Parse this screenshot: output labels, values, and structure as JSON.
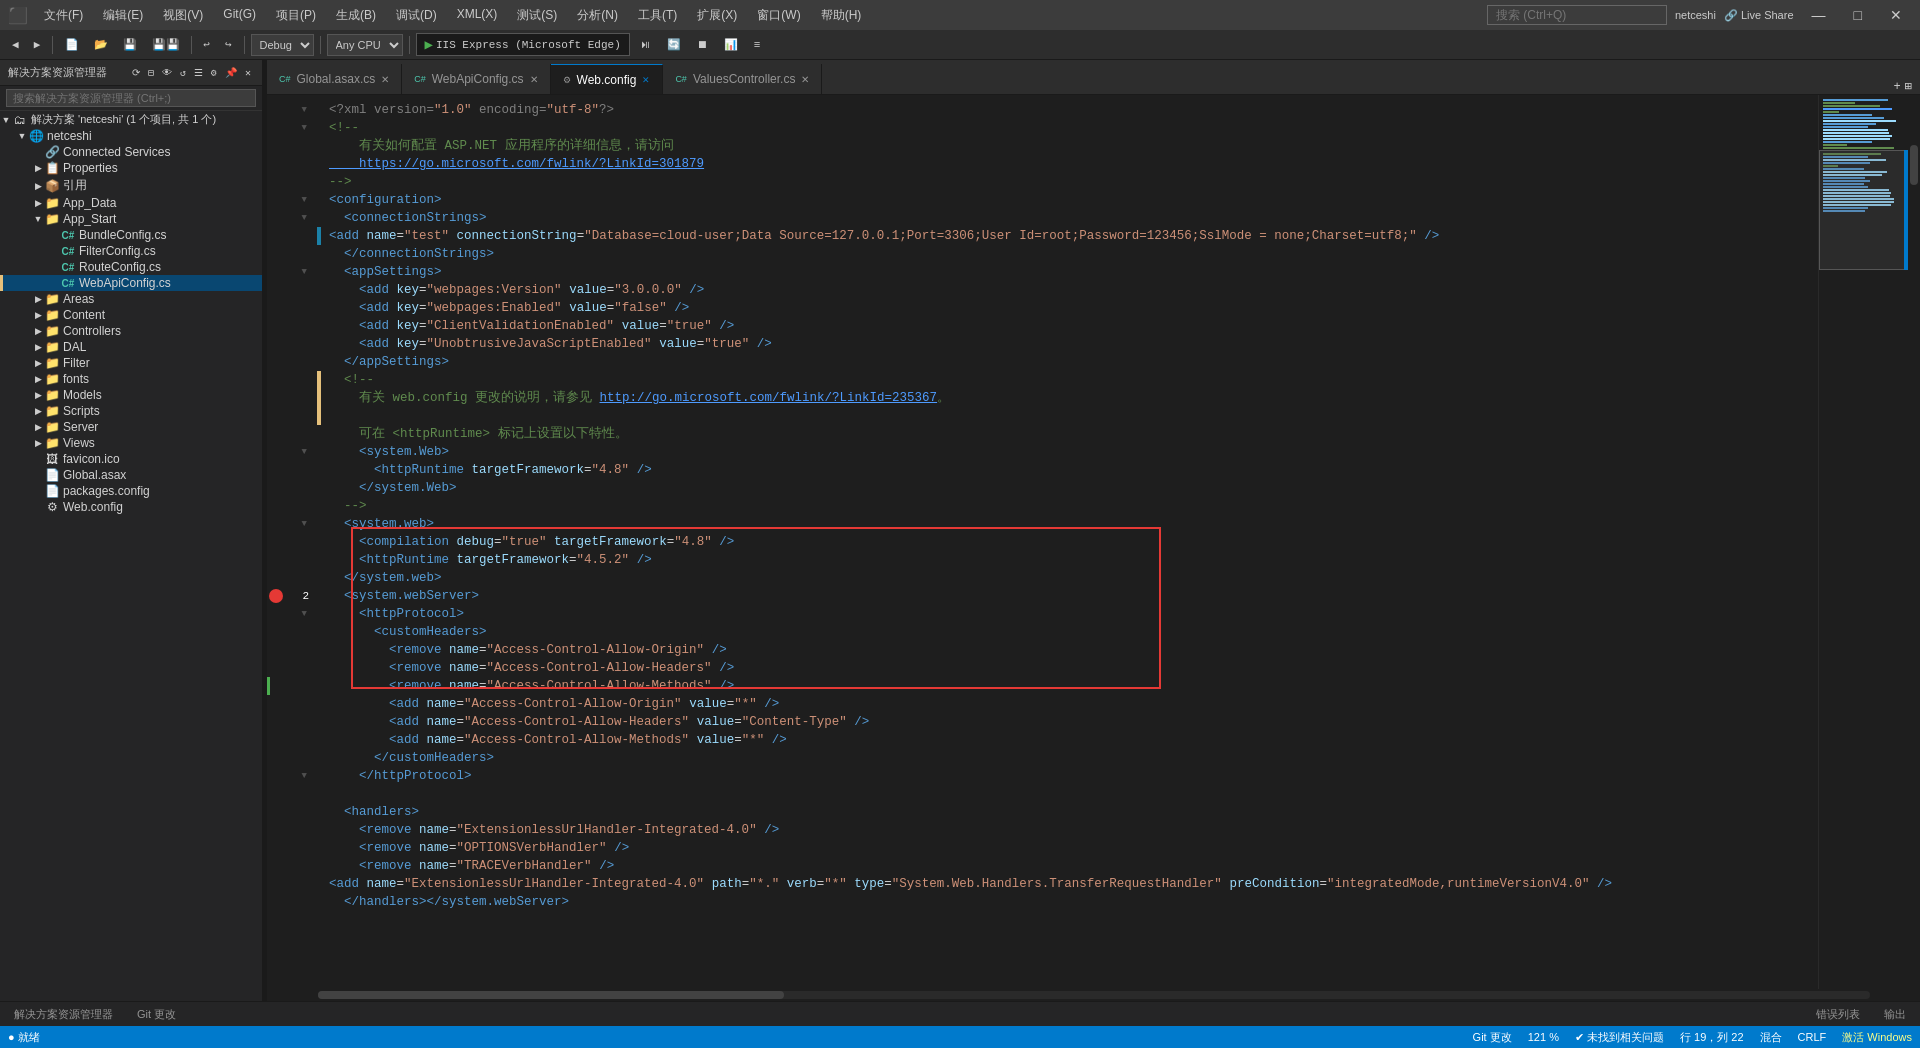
{
  "titleBar": {
    "menuItems": [
      "文件(F)",
      "编辑(E)",
      "视图(V)",
      "Git(G)",
      "项目(P)",
      "生成(B)",
      "调试(D)",
      "XML(X)",
      "测试(S)",
      "分析(N)",
      "工具(T)",
      "扩展(X)",
      "窗口(W)",
      "帮助(H)"
    ],
    "searchPlaceholder": "搜索 (Ctrl+Q)",
    "userName": "netceshi",
    "liveShare": "Live Share",
    "windowControls": [
      "—",
      "□",
      "✕"
    ]
  },
  "toolbar": {
    "config": "Debug",
    "platform": "Any CPU",
    "runTarget": "IIS Express (Microsoft Edge)"
  },
  "solutionExplorer": {
    "title": "解决方案资源管理器",
    "searchPlaceholder": "搜索解决方案资源管理器 (Ctrl+;)",
    "solutionName": "解决方案 'netceshi' (1 个项目, 共 1 个)",
    "projectName": "netceshi",
    "items": [
      {
        "label": "Connected Services",
        "indent": 2,
        "icon": "🔗",
        "type": "item"
      },
      {
        "label": "Properties",
        "indent": 2,
        "icon": "📋",
        "type": "folder"
      },
      {
        "label": "引用",
        "indent": 2,
        "icon": "📦",
        "type": "folder"
      },
      {
        "label": "App_Data",
        "indent": 2,
        "icon": "📁",
        "type": "folder"
      },
      {
        "label": "App_Start",
        "indent": 2,
        "icon": "📁",
        "type": "folder",
        "expanded": true
      },
      {
        "label": "BundleConfig.cs",
        "indent": 3,
        "icon": "C#",
        "type": "file"
      },
      {
        "label": "FilterConfig.cs",
        "indent": 3,
        "icon": "C#",
        "type": "file"
      },
      {
        "label": "RouteConfig.cs",
        "indent": 3,
        "icon": "C#",
        "type": "file"
      },
      {
        "label": "WebApiConfig.cs",
        "indent": 3,
        "icon": "C#",
        "type": "file",
        "selected": true
      },
      {
        "label": "Areas",
        "indent": 2,
        "icon": "📁",
        "type": "folder"
      },
      {
        "label": "Content",
        "indent": 2,
        "icon": "📁",
        "type": "folder"
      },
      {
        "label": "Controllers",
        "indent": 2,
        "icon": "📁",
        "type": "folder"
      },
      {
        "label": "DAL",
        "indent": 2,
        "icon": "📁",
        "type": "folder"
      },
      {
        "label": "Filter",
        "indent": 2,
        "icon": "📁",
        "type": "folder"
      },
      {
        "label": "fonts",
        "indent": 2,
        "icon": "📁",
        "type": "folder"
      },
      {
        "label": "Models",
        "indent": 2,
        "icon": "📁",
        "type": "folder"
      },
      {
        "label": "Scripts",
        "indent": 2,
        "icon": "📁",
        "type": "folder"
      },
      {
        "label": "Server",
        "indent": 2,
        "icon": "📁",
        "type": "folder"
      },
      {
        "label": "Views",
        "indent": 2,
        "icon": "📁",
        "type": "folder"
      },
      {
        "label": "favicon.ico",
        "indent": 2,
        "icon": "🖼",
        "type": "file"
      },
      {
        "label": "Global.asax",
        "indent": 2,
        "icon": "📄",
        "type": "file"
      },
      {
        "label": "packages.config",
        "indent": 2,
        "icon": "📄",
        "type": "file"
      },
      {
        "label": "Web.config",
        "indent": 2,
        "icon": "⚙",
        "type": "file"
      }
    ]
  },
  "tabs": [
    {
      "label": "Global.asax.cs",
      "active": false,
      "modified": false
    },
    {
      "label": "WebApiConfig.cs",
      "active": false,
      "modified": false
    },
    {
      "label": "Web.config",
      "active": true,
      "modified": false,
      "pinned": false
    },
    {
      "label": "ValuesController.cs",
      "active": false,
      "modified": false
    }
  ],
  "codeLines": [
    {
      "num": "",
      "fold": "▼",
      "code": "<?xml version=\"1.0\" encoding=\"utf-8\"?>",
      "class": "xml-pi"
    },
    {
      "num": "",
      "fold": "▼",
      "code": "<!--",
      "class": "xml-comment"
    },
    {
      "num": "",
      "fold": "",
      "code": "    有关如何配置 ASP.NET 应用程序的详细信息，请访问",
      "class": "xml-comment"
    },
    {
      "num": "",
      "fold": "",
      "code": "    https://go.microsoft.com/fwlink/?LinkId=301879",
      "class": "link-color"
    },
    {
      "num": "",
      "fold": "",
      "code": "-->",
      "class": "xml-comment"
    },
    {
      "num": "",
      "fold": "▼",
      "code": "<configuration>",
      "class": "xml-tag"
    },
    {
      "num": "",
      "fold": "▼",
      "code": "  <connectionStrings>",
      "class": "xml-tag"
    },
    {
      "num": "",
      "fold": "",
      "code": "    <add name=\"test\" connectionString=\"Database=cloud-user;Data Source=127.0.0.1;Port=3306;User Id=root;Password=123456;SslMode = none;Charset=utf8;\" />",
      "class": "xml-attr"
    },
    {
      "num": "",
      "fold": "",
      "code": "  </connectionStrings>",
      "class": "xml-tag"
    },
    {
      "num": "",
      "fold": "▼",
      "code": "  <appSettings>",
      "class": "xml-tag"
    },
    {
      "num": "",
      "fold": "",
      "code": "    <add key=\"webpages:Version\" value=\"3.0.0.0\" />",
      "class": "xml-attr"
    },
    {
      "num": "",
      "fold": "",
      "code": "    <add key=\"webpages:Enabled\" value=\"false\" />",
      "class": "xml-attr"
    },
    {
      "num": "",
      "fold": "",
      "code": "    <add key=\"ClientValidationEnabled\" value=\"true\" />",
      "class": "xml-attr"
    },
    {
      "num": "",
      "fold": "",
      "code": "    <add key=\"UnobtrusiveJavaScriptEnabled\" value=\"true\" />",
      "class": "xml-attr"
    },
    {
      "num": "",
      "fold": "",
      "code": "  </appSettings>",
      "class": "xml-tag"
    },
    {
      "num": "",
      "fold": "",
      "code": "  <!--",
      "class": "xml-comment"
    },
    {
      "num": "",
      "fold": "",
      "code": "    有关 web.config 更改的说明，请参见 http://go.microsoft.com/fwlink/?LinkId=235367。",
      "class": "xml-comment"
    },
    {
      "num": "",
      "fold": "",
      "code": "",
      "class": ""
    },
    {
      "num": "",
      "fold": "",
      "code": "    可在 <httpRuntime> 标记上设置以下特性。",
      "class": "xml-comment"
    },
    {
      "num": "",
      "fold": "▼",
      "code": "    <system.Web>",
      "class": "xml-tag"
    },
    {
      "num": "",
      "fold": "",
      "code": "      <httpRuntime targetFramework=\"4.8\" />",
      "class": "xml-attr"
    },
    {
      "num": "",
      "fold": "",
      "code": "    </system.Web>",
      "class": "xml-tag"
    },
    {
      "num": "",
      "fold": "",
      "code": "  -->",
      "class": "xml-comment"
    },
    {
      "num": "",
      "fold": "▼",
      "code": "  <system.web>",
      "class": "xml-tag"
    },
    {
      "num": "",
      "fold": "",
      "code": "    <compilation debug=\"true\" targetFramework=\"4.8\" />",
      "class": "xml-attr"
    },
    {
      "num": "",
      "fold": "",
      "code": "    <httpRuntime targetFramework=\"4.5.2\" />",
      "class": "xml-attr"
    },
    {
      "num": "",
      "fold": "",
      "code": "  </system.web>",
      "class": "xml-tag"
    },
    {
      "num": "",
      "fold": "▼",
      "code": "  <system.webServer>",
      "class": "xml-tag"
    },
    {
      "num": "2",
      "fold": "▼",
      "code": "    <httpProtocol>",
      "class": "xml-tag",
      "bp": true
    },
    {
      "num": "",
      "fold": "▼",
      "code": "      <customHeaders>",
      "class": "xml-tag",
      "highlight": true
    },
    {
      "num": "",
      "fold": "",
      "code": "        <remove name=\"Access-Control-Allow-Origin\" />",
      "class": "xml-attr",
      "highlight": true
    },
    {
      "num": "",
      "fold": "",
      "code": "        <remove name=\"Access-Control-Allow-Headers\" />",
      "class": "xml-attr",
      "highlight": true
    },
    {
      "num": "",
      "fold": "",
      "code": "        <remove name=\"Access-Control-Allow-Methods\" />",
      "class": "xml-attr",
      "highlight": true
    },
    {
      "num": "",
      "fold": "",
      "code": "        <add name=\"Access-Control-Allow-Origin\" value=\"*\" />",
      "class": "xml-attr",
      "highlight": true,
      "change": true
    },
    {
      "num": "",
      "fold": "",
      "code": "        <add name=\"Access-Control-Allow-Headers\" value=\"Content-Type\" />",
      "class": "xml-attr",
      "highlight": true
    },
    {
      "num": "",
      "fold": "",
      "code": "        <add name=\"Access-Control-Allow-Methods\" value=\"*\" />",
      "class": "xml-attr",
      "highlight": true,
      "change2": true
    },
    {
      "num": "",
      "fold": "",
      "code": "      </customHeaders>",
      "class": "xml-tag",
      "highlight": true
    },
    {
      "num": "",
      "fold": "",
      "code": "    </httpProtocol>",
      "class": "xml-tag"
    },
    {
      "num": "",
      "fold": "▼",
      "code": "  <handlers>",
      "class": "xml-tag"
    },
    {
      "num": "",
      "fold": "",
      "code": "    <remove name=\"ExtensionlessUrlHandler-Integrated-4.0\" />",
      "class": "xml-attr"
    },
    {
      "num": "",
      "fold": "",
      "code": "    <remove name=\"OPTIONSVerbHandler\" />",
      "class": "xml-attr"
    },
    {
      "num": "",
      "fold": "",
      "code": "    <remove name=\"TRACEVerbHandler\" />",
      "class": "xml-attr"
    },
    {
      "num": "",
      "fold": "",
      "code": "    <add name=\"ExtensionlessUrlHandler-Integrated-4.0\" path=\"*.\" verb=\"*\" type=\"System.Web.Handlers.TransferRequestHandler\" preCondition=\"integratedMode,runtimeVersionV4.0\" />",
      "class": "xml-attr"
    },
    {
      "num": "",
      "fold": "",
      "code": "  </handlers></system.webServer>",
      "class": "xml-tag"
    }
  ],
  "statusBar": {
    "left": [
      "● 就绪"
    ],
    "gitBranch": "Git 更改",
    "zoomLevel": "121 %",
    "noErrors": "✔ 未找到相关问题",
    "position": "行 19，列 22",
    "merge": "混合",
    "lineEnding": "CRLF",
    "encoding": "CRLF",
    "activateWindows": "激活 Windows"
  },
  "bottomBar": {
    "tabs": [
      "解决方案资源管理器",
      "Git 更改"
    ],
    "rightTabs": [
      "错误列表",
      "输出"
    ]
  }
}
